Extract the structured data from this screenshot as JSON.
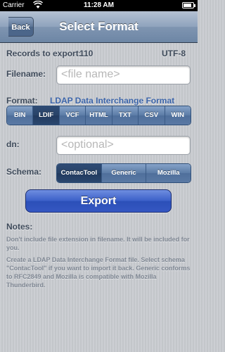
{
  "status_bar": {
    "carrier": "Carrier",
    "time": "11:28 AM",
    "wifi_icon": "wifi-icon",
    "battery_icon": "battery-icon"
  },
  "nav": {
    "back_label": "Back",
    "title": "Select Format"
  },
  "records": {
    "label": "Records to export:",
    "count": "110",
    "encoding": "UTF-8"
  },
  "filename": {
    "label": "Filename:",
    "placeholder": "<file name>"
  },
  "format": {
    "label": "Format:",
    "value": "LDAP Data Interchange Format",
    "options": [
      "BIN",
      "LDIF",
      "VCF",
      "HTML",
      "TXT",
      "CSV",
      "WIN"
    ],
    "selected": "LDIF"
  },
  "dn": {
    "label": "dn:",
    "placeholder": "<optional>"
  },
  "schema": {
    "label": "Schema:",
    "options": [
      "ContacTool",
      "Generic",
      "Mozilla"
    ],
    "selected": "ContacTool"
  },
  "export_button": "Export",
  "notes": {
    "title": "Notes:",
    "line1": "Don't include file extension in filename. It will be included for you.",
    "line2": "Create a LDAP Data Interchange Format file. Select schema \"ContacTool\" if you want to import it back. Generic conforms to RFC2849 and Mozilla is compatible with Mozilla Thunderbird."
  },
  "colors": {
    "nav_bar": "#7f95b1",
    "selected_segment": "#284368",
    "export_button": "#3a5fc8",
    "format_value": "#3a63a8"
  }
}
